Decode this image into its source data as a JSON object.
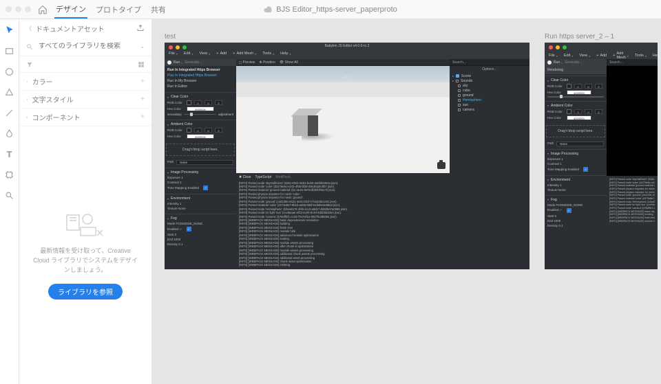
{
  "app": {
    "tabs": [
      "デザイン",
      "プロトタイプ",
      "共有"
    ],
    "active_tab": 0,
    "document_title": "BJS Editor_https-server_paperproto"
  },
  "tool_rail": [
    {
      "name": "select-tool",
      "active": true
    },
    {
      "name": "rectangle-tool",
      "active": false
    },
    {
      "name": "ellipse-tool",
      "active": false
    },
    {
      "name": "polygon-tool",
      "active": false
    },
    {
      "name": "line-tool",
      "active": false
    },
    {
      "name": "pen-tool",
      "active": false
    },
    {
      "name": "text-tool",
      "active": false
    },
    {
      "name": "artboard-tool",
      "active": false
    },
    {
      "name": "zoom-tool",
      "active": false
    }
  ],
  "panel": {
    "title": "ドキュメントアセット",
    "search_placeholder": "すべてのライブラリを検索",
    "sections": [
      "カラー",
      "文字スタイル",
      "コンポーネント"
    ],
    "empty_msg": "最新情報を受け取って、Creative Cloud ライブラリでシステムをデザインしましょう。",
    "button_label": "ライブラリを参照"
  },
  "artboards": [
    {
      "label": "test"
    },
    {
      "label": "Run https server_2 – 1"
    }
  ],
  "editor": {
    "title": "Babylon JS Editor v4.0.0-rc.3",
    "menu": [
      "File",
      "Edit",
      "View",
      "Add",
      "Add Mesh",
      "Tools",
      "Help"
    ],
    "run_tabs": [
      "Run...",
      "Generate..."
    ],
    "run_items": [
      "Run In Integrated Https Browser",
      "Play In Integrated Https Browser",
      "Run In My Browser",
      "Run In Editor"
    ],
    "toolbar_items": [
      "Preview",
      "Position",
      "Show All"
    ],
    "inspector": {
      "groups": [
        {
          "name": "Clear Color",
          "rows": [
            {
              "label": "RGB Color",
              "fields": [
                "0",
                "0",
                "0"
              ]
            },
            {
              "label": "Hex Color",
              "value": "#000000"
            }
          ],
          "slider_label_left": "secondary",
          "slider_label_right": "adjustment"
        },
        {
          "name": "Ambient Color",
          "rows": [
            {
              "label": "RGB Color",
              "fields": [
                "0",
                "0",
                "0"
              ]
            },
            {
              "label": "Hex Color",
              "value": "#000000"
            }
          ]
        },
        {
          "name": "Image Processing",
          "simple_rows": [
            "Exposure   1",
            "Contrast   1",
            "Tone Mapping Enabled"
          ]
        },
        {
          "name": "Environment",
          "simple_rows": [
            "Intensity   1",
            "Texture   None"
          ]
        },
        {
          "name": "Fog",
          "simple_rows": [
            "Mode   FOGMODE_NONE",
            "Enabled   ✓",
            "Start   0",
            "End   1000",
            "Density   0.1"
          ]
        }
      ],
      "dropzone": "Drag'n'drop script here.",
      "path_label": "Path",
      "path_value": "None"
    },
    "outliner": {
      "search": "Search...",
      "options": "Options...",
      "items": [
        {
          "label": "Scene",
          "kind": "scene"
        },
        {
          "label": "Sounds",
          "kind": "group"
        },
        {
          "label": "sky",
          "kind": "item",
          "indent": 1
        },
        {
          "label": "cube",
          "kind": "item",
          "indent": 1
        },
        {
          "label": "ground",
          "kind": "item",
          "indent": 1
        },
        {
          "label": "Hemispheric",
          "kind": "item",
          "indent": 1,
          "selected": true
        },
        {
          "label": "sun",
          "kind": "item",
          "indent": 1
        },
        {
          "label": "camera",
          "kind": "item",
          "indent": 1
        }
      ]
    },
    "console": {
      "tabs": [
        "Clear",
        "TypeScript",
        "WebPack"
      ],
      "lines": [
        "[INFO] Parsed node 'skyHalfSize2' (5481-03d1-9e81-be50-4a0bb8304a json).",
        "[INFO] Parsed node 'cube' (d2278e6c-e2cb-4f58-bf25-38e35a3e3fb7 json).",
        "[INFO] Parsed material 'ground-material' (b1-4e15-3978-dbfefcf05178 json).",
        "[INFO] Parsed physics impostor for mesh 'cube'.",
        "[INFO] Parsed physics impostor for mesh 'ground'.",
        "[INFO] Parsed node 'ground' (c4d139e-4421-4e3c-bb1f-17ea436cce01 json).",
        "[INFO] Parsed material 'cube' (c573a8e7-9b15-a455-082f-e2dd5e3e56a4 json).",
        "[INFO] Parsed node 'Hemispheric' (b3ee8178-1f26-4cc2-a8d17-8d62947a0988 json).",
        "[INFO] Parsed node for light 'sun' (cce9aaae-ef22-4c20-8c43-6d2b5533e4 json).",
        "[INFO] Parsed node 'camera' (b78eff6f1-cc20-f7ed-ef1a-9027fe288394 json).",
        "[INFO] [WEBPACK MESSAGE] basic dependencies resolution",
        "[INFO] [WEBPACK MESSAGE] building",
        "[INFO] [WEBPACK MESSAGE] finish time",
        "[INFO] [WEBPACK MESSAGE] module hide",
        "[INFO] [WEBPACK MESSAGE] advanced module optimization",
        "[INFO] [WEBPACK MESSAGE] sealing",
        "[INFO] [WEBPACK MESSAGE] module assets processing",
        "[INFO] [WEBPACK MESSAGE] after chunk id optimization",
        "[INFO] [WEBPACK MESSAGE] module assets processing",
        "[INFO] [WEBPACK MESSAGE] additional chunk assets processing",
        "[INFO] [WEBPACK MESSAGE] additional asset processing",
        "[INFO] [WEBPACK MESSAGE] chunk asset optimization",
        "[INFO] [WEBPACK MESSAGE] emitting"
      ]
    },
    "rendering_tab": "Rendering"
  }
}
